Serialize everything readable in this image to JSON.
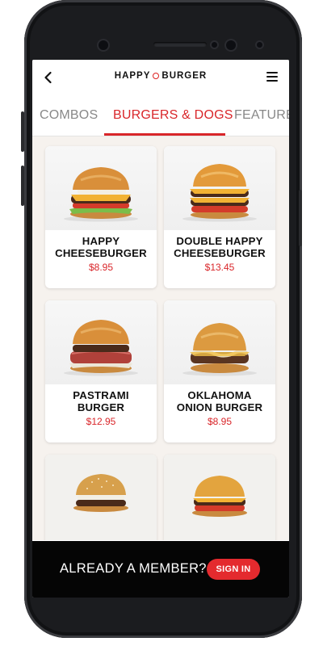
{
  "header": {
    "logo_left": "HAPPY",
    "logo_right": "BURGER"
  },
  "tabs": [
    {
      "label": "COMBOS"
    },
    {
      "label": "BURGERS & DOGS"
    },
    {
      "label": "FEATURE"
    }
  ],
  "items": [
    {
      "name_line1": "HAPPY",
      "name_line2": "CHEESEBURGER",
      "price": "$8.95"
    },
    {
      "name_line1": "DOUBLE HAPPY",
      "name_line2": "CHEESEBURGER",
      "price": "$13.45"
    },
    {
      "name_line1": "PASTRAMI",
      "name_line2": "BURGER",
      "price": "$12.95"
    },
    {
      "name_line1": "OKLAHOMA",
      "name_line2": "ONION BURGER",
      "price": "$8.95"
    }
  ],
  "footer": {
    "prompt": "ALREADY A MEMBER?",
    "sign_in": "SIGN IN"
  },
  "colors": {
    "accent": "#d9262a",
    "footer_bg": "#050505",
    "content_bg": "#f6f2ee"
  }
}
